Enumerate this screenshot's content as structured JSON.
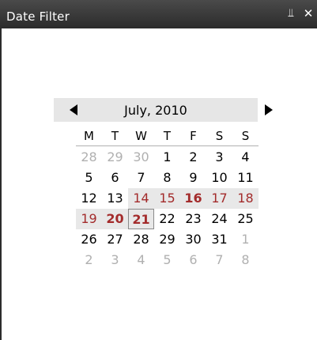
{
  "window": {
    "title": "Date Filter",
    "pin_icon": "pin-icon",
    "close_icon": "close-icon"
  },
  "calendar": {
    "month_label": "July, 2010",
    "prev_icon": "triangle-left-icon",
    "next_icon": "triangle-right-icon",
    "day_headers": [
      "M",
      "T",
      "W",
      "T",
      "F",
      "S",
      "S"
    ],
    "accent_color": "#a32b2b",
    "weeks": [
      [
        {
          "d": "28",
          "state": "other"
        },
        {
          "d": "29",
          "state": "other"
        },
        {
          "d": "30",
          "state": "other"
        },
        {
          "d": "1",
          "state": "normal"
        },
        {
          "d": "2",
          "state": "normal"
        },
        {
          "d": "3",
          "state": "normal"
        },
        {
          "d": "4",
          "state": "normal"
        }
      ],
      [
        {
          "d": "5",
          "state": "normal"
        },
        {
          "d": "6",
          "state": "normal"
        },
        {
          "d": "7",
          "state": "normal"
        },
        {
          "d": "8",
          "state": "normal"
        },
        {
          "d": "9",
          "state": "normal"
        },
        {
          "d": "10",
          "state": "normal"
        },
        {
          "d": "11",
          "state": "normal"
        }
      ],
      [
        {
          "d": "12",
          "state": "normal"
        },
        {
          "d": "13",
          "state": "normal"
        },
        {
          "d": "14",
          "state": "range-red"
        },
        {
          "d": "15",
          "state": "range-red"
        },
        {
          "d": "16",
          "state": "range-red-bold"
        },
        {
          "d": "17",
          "state": "range-red"
        },
        {
          "d": "18",
          "state": "range-red"
        }
      ],
      [
        {
          "d": "19",
          "state": "range-red"
        },
        {
          "d": "20",
          "state": "range-red-bold"
        },
        {
          "d": "21",
          "state": "today"
        },
        {
          "d": "22",
          "state": "normal"
        },
        {
          "d": "23",
          "state": "normal"
        },
        {
          "d": "24",
          "state": "normal"
        },
        {
          "d": "25",
          "state": "normal"
        }
      ],
      [
        {
          "d": "26",
          "state": "normal"
        },
        {
          "d": "27",
          "state": "normal"
        },
        {
          "d": "28",
          "state": "normal"
        },
        {
          "d": "29",
          "state": "normal"
        },
        {
          "d": "30",
          "state": "normal"
        },
        {
          "d": "31",
          "state": "normal"
        },
        {
          "d": "1",
          "state": "other"
        }
      ],
      [
        {
          "d": "2",
          "state": "other"
        },
        {
          "d": "3",
          "state": "other"
        },
        {
          "d": "4",
          "state": "other"
        },
        {
          "d": "5",
          "state": "other"
        },
        {
          "d": "6",
          "state": "other"
        },
        {
          "d": "7",
          "state": "other"
        },
        {
          "d": "8",
          "state": "other"
        }
      ]
    ]
  }
}
